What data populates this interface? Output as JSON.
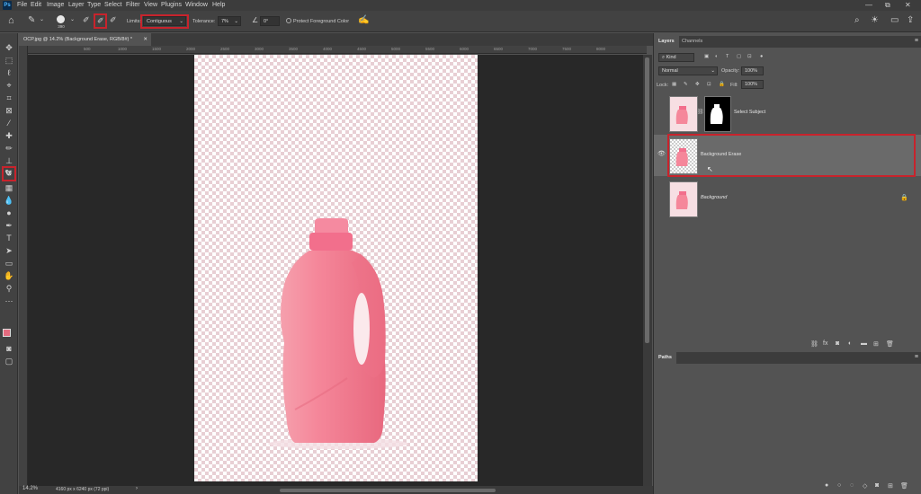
{
  "app": {
    "logo_text": "Ps"
  },
  "menu": [
    "File",
    "Edit",
    "Image",
    "Layer",
    "Type",
    "Select",
    "Filter",
    "View",
    "Plugins",
    "Window",
    "Help"
  ],
  "window_controls": {
    "minimize": "—",
    "restore": "⧉",
    "close": "✕"
  },
  "options_bar": {
    "brush_size": "390",
    "limits_label": "Limits:",
    "limits_value": "Contiguous",
    "tolerance_label": "Tolerance:",
    "tolerance_value": "7%",
    "angle_value": "0°",
    "protect_label": "Protect Foreground Color"
  },
  "document": {
    "tab_title": "OCP.jpg @ 14.2% (Background Erase, RGB/8#) *",
    "status_zoom": "14.2%",
    "status_info": "4160 px x 6240 px (72 ppi)",
    "ruler_ticks": [
      "500",
      "1000",
      "1500",
      "2000",
      "2500",
      "3000",
      "3500",
      "4000",
      "4500",
      "5000",
      "5500",
      "6000",
      "6500",
      "7000",
      "7500",
      "8000",
      "8500"
    ]
  },
  "layers_panel": {
    "tabs": [
      "Layers",
      "Channels"
    ],
    "filter_kind": "Kind",
    "blend_mode": "Normal",
    "opacity_label": "Opacity:",
    "opacity_value": "100%",
    "lock_label": "Lock:",
    "fill_label": "Fill:",
    "fill_value": "100%",
    "layers": [
      {
        "name": "Select Subject",
        "visible": false,
        "selected": false
      },
      {
        "name": "Background Erase",
        "visible": true,
        "selected": true
      },
      {
        "name": "Background",
        "visible": false,
        "selected": false,
        "locked": true
      }
    ]
  },
  "paths_panel": {
    "tab": "Paths"
  },
  "colors": {
    "highlight": "#c8232c",
    "product_pink": "#f27b8f",
    "foreground": "#e46b7f"
  }
}
